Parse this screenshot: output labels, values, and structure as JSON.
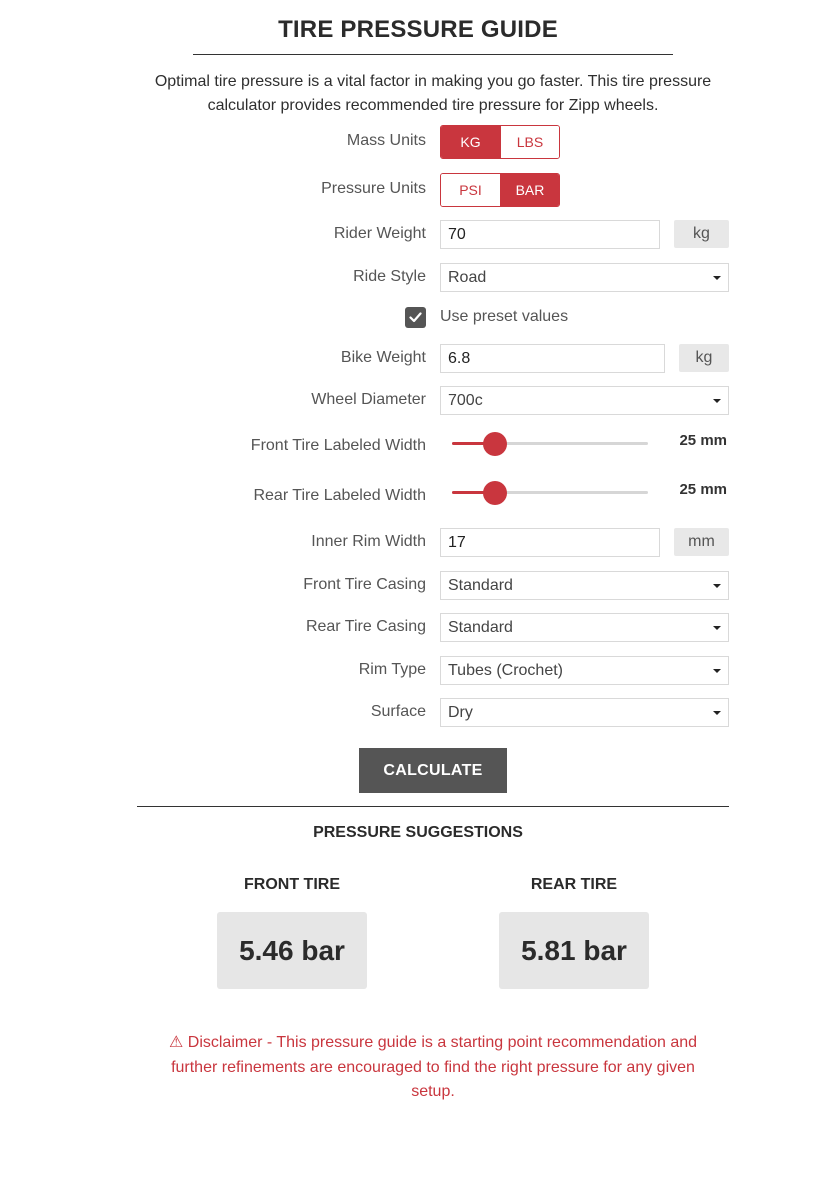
{
  "page": {
    "title": "TIRE PRESSURE GUIDE",
    "intro": "Optimal tire pressure is a vital factor in making you go faster. This tire pressure calculator provides recommended tire pressure for Zipp wheels."
  },
  "form": {
    "mass_units": {
      "label": "Mass Units",
      "options": [
        "KG",
        "LBS"
      ],
      "selected": "KG"
    },
    "pressure_units": {
      "label": "Pressure Units",
      "options": [
        "PSI",
        "BAR"
      ],
      "selected": "BAR"
    },
    "rider_weight": {
      "label": "Rider Weight",
      "value": "70",
      "unit": "kg"
    },
    "ride_style": {
      "label": "Ride Style",
      "value": "Road"
    },
    "preset": {
      "label": "Use preset values",
      "checked": true
    },
    "bike_weight": {
      "label": "Bike Weight",
      "value": "6.8",
      "unit": "kg"
    },
    "wheel_diameter": {
      "label": "Wheel Diameter",
      "value": "700c"
    },
    "front_tire_width": {
      "label": "Front Tire Labeled Width",
      "value_text": "25 mm",
      "slider_fraction": 0.22
    },
    "rear_tire_width": {
      "label": "Rear Tire Labeled Width",
      "value_text": "25 mm",
      "slider_fraction": 0.22
    },
    "inner_rim_width": {
      "label": "Inner Rim Width",
      "value": "17",
      "unit": "mm"
    },
    "front_tire_casing": {
      "label": "Front Tire Casing",
      "value": "Standard"
    },
    "rear_tire_casing": {
      "label": "Rear Tire Casing",
      "value": "Standard"
    },
    "rim_type": {
      "label": "Rim Type",
      "value": "Tubes (Crochet)"
    },
    "surface": {
      "label": "Surface",
      "value": "Dry"
    },
    "calculate_label": "CALCULATE"
  },
  "results": {
    "title": "PRESSURE SUGGESTIONS",
    "front": {
      "label": "FRONT TIRE",
      "value": "5.46 bar"
    },
    "rear": {
      "label": "REAR TIRE",
      "value": "5.81 bar"
    }
  },
  "disclaimer": {
    "icon": "warning-icon",
    "text": "⚠ Disclaimer - This pressure guide is a starting point recommendation and further refinements are encouraged to find the right pressure for any given setup."
  },
  "colors": {
    "accent": "#c9363e",
    "button_dark": "#555555",
    "result_bg": "#e6e6e6"
  }
}
